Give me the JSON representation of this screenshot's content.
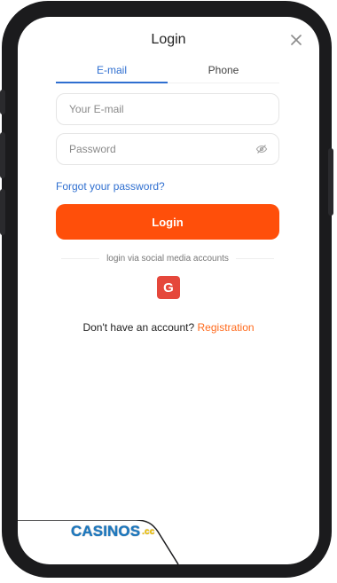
{
  "header": {
    "title": "Login"
  },
  "tabs": [
    {
      "label": "E-mail",
      "active": true
    },
    {
      "label": "Phone",
      "active": false
    }
  ],
  "form": {
    "email_placeholder": "Your E-mail",
    "email_value": "",
    "password_placeholder": "Password",
    "password_value": ""
  },
  "links": {
    "forgot_password": "Forgot your password?",
    "registration_prefix": "Don't have an account?",
    "registration": "Registration"
  },
  "actions": {
    "login_label": "Login"
  },
  "social": {
    "divider_text": "login via social media accounts",
    "google_letter": "G"
  },
  "brand": {
    "logo_text": "CASINOS",
    "logo_suffix": ".cc"
  },
  "colors": {
    "accent_blue": "#2f6fd0",
    "accent_orange": "#ff4f0a",
    "google_red": "#e5473b"
  },
  "icons": {
    "close": "close-icon",
    "eye": "eye-off-icon"
  }
}
